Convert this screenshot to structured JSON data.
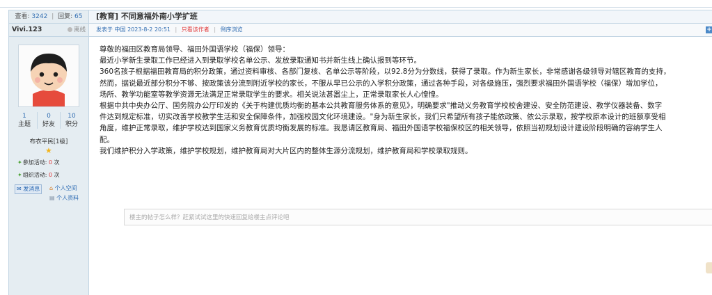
{
  "thread_stats": {
    "views_label": "查看:",
    "views": "3242",
    "replies_label": "回复:",
    "replies": "65"
  },
  "thread": {
    "category": "[教育]",
    "title": "不同意福外南小学扩班"
  },
  "author": {
    "name": "Vivi.123",
    "status": "离线",
    "stats": [
      {
        "value": "1",
        "label": "主题"
      },
      {
        "value": "0",
        "label": "好友"
      },
      {
        "value": "10",
        "label": "积分"
      }
    ],
    "rank": "布衣平民[1级]",
    "activity_join": {
      "label": "参加活动:",
      "value": "0",
      "unit": "次"
    },
    "activity_organize": {
      "label": "组织活动:",
      "value": "0",
      "unit": "次"
    },
    "send_message": "发消息",
    "personal_space": "个人空间",
    "personal_profile": "个人资料"
  },
  "post_meta": {
    "posted": "发表于 中国 2023-8-2 20:51",
    "author_only": "只看该作者",
    "reverse": "倒序浏览"
  },
  "post_body": [
    "尊敬的福田区教育局领导、福田外国语学校（福保）领导：",
    "最近小学新生录取工作已经进入到录取学校名单公示、发放录取通知书并新生线上确认报到等环节。",
    "360名孩子根据福田教育局的积分政策，通过资料审核、各部门复核、名单公示等阶段，以92.8分为分数线，获得了录取。作为新生家长，非常感谢各级领导对辖区教育的支持，",
    "然而，据说最近部分积分不够、按政策该分流到附近学校的家长，不服从早已公示的入学积分政策，通过各种手段，对各级施压，强烈要求福田外国语学校（福保）增加学位，",
    "场所、教学功能室等教学资源无法满足正常录取学生的要求。相关说法甚嚣尘上，正常录取家长人心惶惶。",
    "根据中共中央办公厅、国务院办公厅印发的《关于构建优质均衡的基本公共教育服务体系的意见》，明确要求\"推动义务教育学校校舍建设、安全防范建设、教学仪器装备、数字",
    "件达到规定标准，切实改善学校教学生活和安全保障条件，加强校园文化环境建设。\"身为新生家长，我们只希望所有孩子能依政策、依公示录取，按学校原本设计的班额享受相",
    "角度，维护正常录取，维护学校达到国家义务教育优质均衡发展的标准。我恳请区教育局、福田外国语学校福保校区的相关领导，依照当初规划设计建设阶段明确的容纳学生人",
    "配。",
    "我们维护积分入学政策，维护学校规划，维护教育局对大片区内的整体生源分流规划，维护教育局和学校录取规则。"
  ],
  "quick_reply": {
    "placeholder": "楼主的帖子怎么样？赶紧试试这里的快速回复给楼主点评论吧"
  },
  "colors": {
    "border": "#c2d5e3",
    "sidebar_bg": "#e5edf2",
    "link": "#3570b3",
    "highlight_red": "#e23b3b"
  }
}
